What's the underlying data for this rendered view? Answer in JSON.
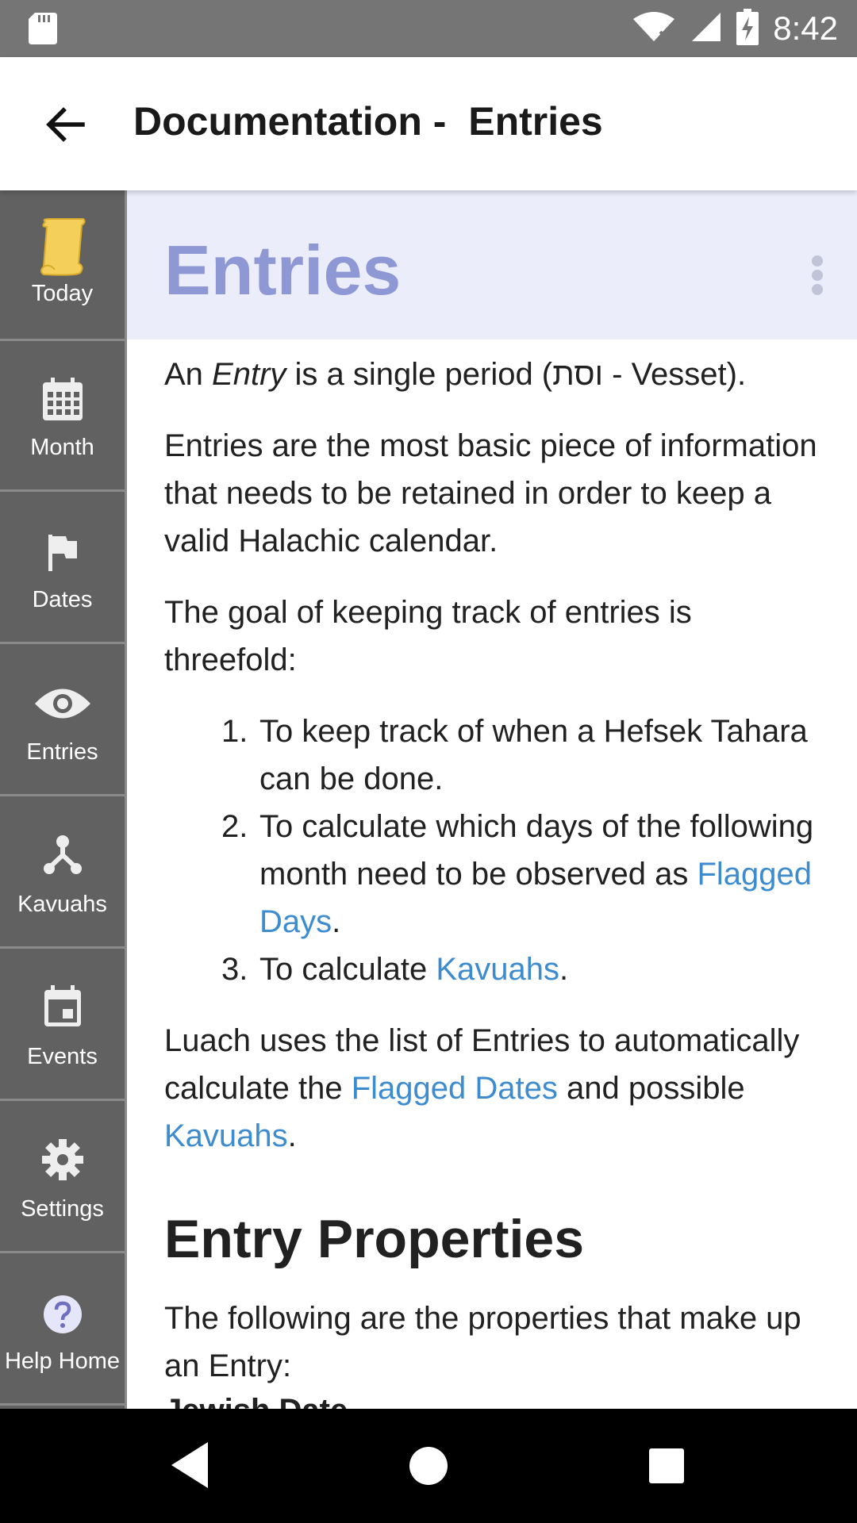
{
  "status_bar": {
    "time": "8:42"
  },
  "app_bar": {
    "title": "Documentation -  Entries"
  },
  "sidebar": {
    "items": [
      {
        "label": "Today",
        "icon": "scroll-icon"
      },
      {
        "label": "Month",
        "icon": "calendar-grid-icon"
      },
      {
        "label": "Dates",
        "icon": "flag-icon"
      },
      {
        "label": "Entries",
        "icon": "eye-icon"
      },
      {
        "label": "Kavuahs",
        "icon": "tree-icon"
      },
      {
        "label": "Events",
        "icon": "event-calendar-icon"
      },
      {
        "label": "Settings",
        "icon": "gear-icon"
      },
      {
        "label": "Help Home",
        "icon": "help-icon"
      }
    ]
  },
  "doc": {
    "title": "Entries",
    "p1": {
      "a": "An ",
      "em": "Entry",
      "b": " is a single period (וסת - Vesset)."
    },
    "p2": "Entries are the most basic piece of information that needs to be retained in order to keep a valid Halachic calendar.",
    "p3": "The goal of keeping track of entries is threefold:",
    "steps": [
      {
        "num": "1.",
        "text": "To keep track of when a Hefsek Tahara can be done."
      },
      {
        "num": "2.",
        "text": "To calculate which days of the following month need to be observed as ",
        "link": "Flagged Days",
        "after": "."
      },
      {
        "num": "3.",
        "text": "To calculate ",
        "link": "Kavuahs",
        "after": "."
      }
    ],
    "p4": {
      "a": "Luach uses the list of Entries to automatically calculate the ",
      "link1": "Flagged Dates",
      "b": " and possible ",
      "link2": "Kavuahs",
      "c": "."
    },
    "h2": "Entry Properties",
    "p5": "The following are the properties that make up an Entry:",
    "p6": "Jewish Date"
  }
}
